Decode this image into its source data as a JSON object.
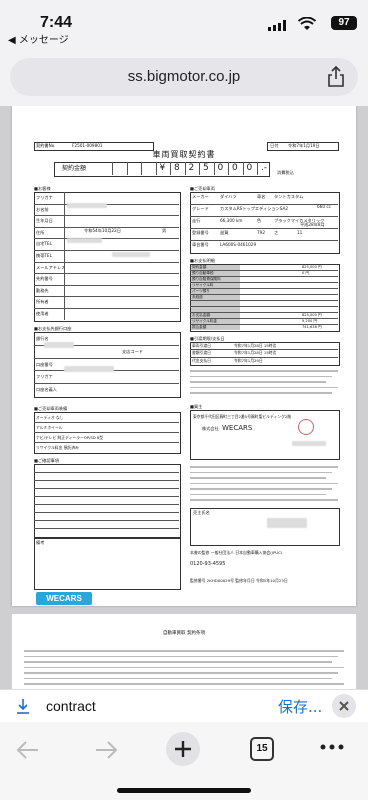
{
  "status": {
    "time": "7:44",
    "back_label": "◀ メッセージ",
    "battery": "97"
  },
  "browser": {
    "url": "ss.bigmotor.co.jp",
    "download_name": "contract",
    "save_label": "保存...",
    "tab_count": "15"
  },
  "doc": {
    "title": "車両買取契約書",
    "contract_no_label": "契約書No.",
    "contract_no": "F2501-009801",
    "date_label": "日付",
    "date": "令和7年1月19日",
    "amount_label": "契約金額",
    "amount_digits": [
      "",
      "",
      "",
      "¥",
      "8",
      "2",
      "5",
      "0",
      "0",
      "0",
      ".-"
    ],
    "tax_label": "消費税込",
    "customer_section": "■お客様",
    "customer_rows": [
      "フリガナ",
      "お名前",
      "生年月日",
      "住所",
      "自宅TEL",
      "携帯TEL",
      "メールアドレス",
      "先約番号",
      "勤務先",
      "所有者",
      "使用者"
    ],
    "birth": "令和54年10月22日",
    "gender": "男",
    "car_section": "■ご売却車両",
    "car_rows": [
      [
        "メーカー",
        "ダイハツ",
        "車名",
        "タントカスタム"
      ],
      [
        "グレード",
        "カスタムRSトップエディションSA2"
      ],
      [
        "走行",
        "66,300 km",
        "色",
        "ブラックマイカメタリック"
      ],
      [
        "登録番号",
        "滋賀",
        "792",
        "さ",
        "11"
      ],
      [
        "車台番号",
        "LA600S-0461029"
      ]
    ],
    "first_reg": "平成28年8月",
    "displacement": "660 cc",
    "payment_section": "■お支払明細",
    "payment_rows": [
      "契約金額",
      "預り自動車税",
      "預り自賠責保険料",
      "リサイクル料",
      "パーツ預り",
      "未経過",
      "",
      "",
      "お支払金額",
      "リサイクル料金",
      "振込金額"
    ],
    "payment_values": [
      "825,000 円",
      "0 円",
      "",
      "",
      "",
      "",
      "",
      "",
      "825,000 円",
      "9,200 円",
      "741,636 円"
    ],
    "bank_section": "■お支払先銀行口座",
    "bank_rows": [
      "銀行名",
      "支店コード",
      "口座番号",
      "フリガナ",
      "口座名義人"
    ],
    "note_section": "■ご売却車両装備",
    "equip_rows": [
      "オーディオ なし",
      "アルミホイール",
      "ナビ/テレビ 純正ディーラーOP/SD 8型",
      "リサイクル料金 預託済み"
    ],
    "condition_section": "■ご確認事項",
    "schedule_section": "■引渡期限/支払日",
    "schedule_rows": [
      "車両引渡日",
      "書類引渡日",
      "代金支払日"
    ],
    "schedule_values": [
      "令和7年1月28日 15時迄",
      "令和7年1月28日 15時迄",
      "令和7年1月29日"
    ],
    "buyer_section": "■買主",
    "buyer_address": "東京都千代田区麹町三丁目2番5号麹町聖ビルディング2階",
    "buyer_company_label": "株式会社",
    "buyer_company": "WECARS",
    "seller_name_label": "売主氏名",
    "remarks_label": "備考",
    "brand": "WECARS",
    "footer_title": "本書の監修 一般社団法人 日本自動車購入協会(JPUC)",
    "footer_phone": "0120-93-4595",
    "footer_reg": "監修番号 2KHD00029号 監修年月日 令和5年10月23日",
    "page2_title": "自動車買取 契約条項"
  }
}
